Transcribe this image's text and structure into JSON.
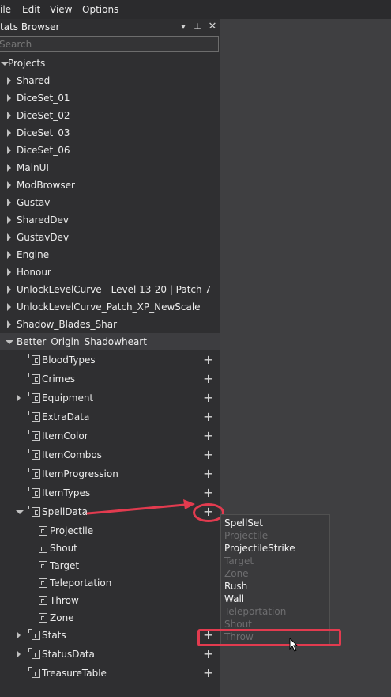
{
  "menubar": {
    "items": [
      {
        "label": "ile"
      },
      {
        "label": "Edit"
      },
      {
        "label": "View"
      },
      {
        "label": "Options"
      }
    ]
  },
  "panel": {
    "title": "tats Browser",
    "icons": [
      "dropdown-icon",
      "pin-icon",
      "close-icon"
    ],
    "search_placeholder": "Search"
  },
  "tree": {
    "root": "Projects",
    "projects": [
      "Shared",
      "DiceSet_01",
      "DiceSet_02",
      "DiceSet_03",
      "DiceSet_06",
      "MainUI",
      "ModBrowser",
      "Gustav",
      "SharedDev",
      "GustavDev",
      "Engine",
      "Honour",
      "UnlockLevelCurve - Level 13-20 | Patch 7",
      "UnlockLevelCurve_Patch_XP_NewScale",
      "Shadow_Blades_Shar",
      "Better_Origin_Shadowheart"
    ],
    "children": [
      "BloodTypes",
      "Crimes",
      "Equipment",
      "ExtraData",
      "ItemColor",
      "ItemCombos",
      "ItemProgression",
      "ItemTypes",
      "SpellData"
    ],
    "spelldata_children": [
      "Projectile",
      "Shout",
      "Target",
      "Teleportation",
      "Throw",
      "Zone"
    ],
    "after_children": [
      "Stats",
      "StatusData",
      "TreasureTable"
    ]
  },
  "context_menu": {
    "items": [
      {
        "label": "SpellSet",
        "enabled": true
      },
      {
        "label": "Projectile",
        "enabled": false
      },
      {
        "label": "ProjectileStrike",
        "enabled": true
      },
      {
        "label": "Target",
        "enabled": false
      },
      {
        "label": "Zone",
        "enabled": false
      },
      {
        "label": "Rush",
        "enabled": true
      },
      {
        "label": "Wall",
        "enabled": true
      },
      {
        "label": "Teleportation",
        "enabled": false
      },
      {
        "label": "Shout",
        "enabled": false
      },
      {
        "label": "Throw",
        "enabled": false
      }
    ]
  },
  "colors": {
    "highlight": "#e23b4f",
    "panel_bg": "#2f2f31",
    "workspace_bg": "#3f3f41"
  }
}
